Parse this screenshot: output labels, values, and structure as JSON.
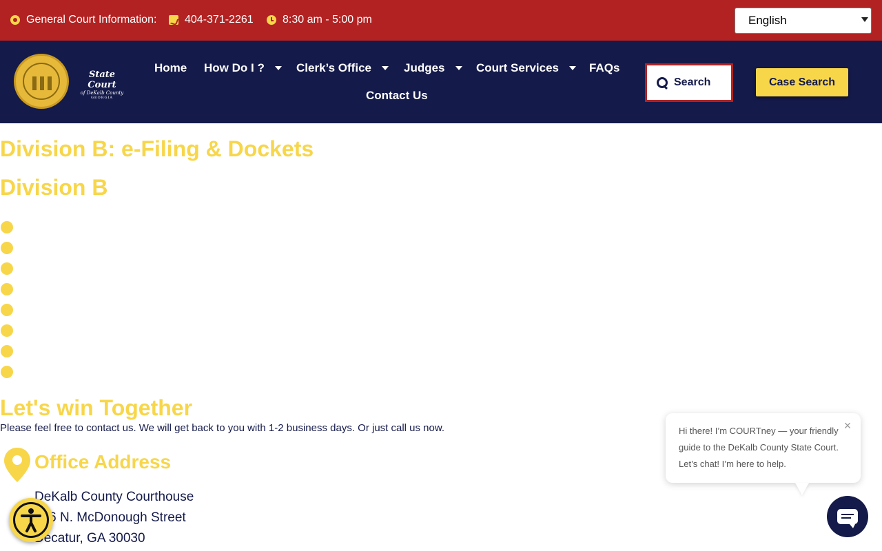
{
  "topbar": {
    "court_info_label": "General Court Information:",
    "phone": "404-371-2261",
    "hours": "8:30 am - 5:00 pm",
    "language": "English"
  },
  "logo": {
    "line1": "State Court",
    "line2": "of DeKalb County",
    "line3": "GEORGIA"
  },
  "nav": {
    "home": "Home",
    "how_do_i": "How Do I ?",
    "clerks_office": "Clerk’s Office",
    "judges": "Judges",
    "court_services": "Court Services",
    "faqs": "FAQs",
    "contact_us": "Contact Us",
    "search_label": "Search",
    "case_search": "Case Search"
  },
  "content": {
    "title": "Division B: e-Filing & Dockets",
    "subtitle": "Division B",
    "win_heading": "Let's win Together",
    "contact_text": "Please feel free to contact us. We will get back to you with 1-2 business days. Or just call us now.",
    "office_title": "Office Address",
    "address_lines": [
      "DeKalb County Courthouse",
      "556 N. McDonough Street",
      "Decatur, GA 30030"
    ]
  },
  "chat": {
    "message": "Hi there! I’m COURTney — your friendly guide to the DeKalb County State Court. Let’s chat! I’m here to help.",
    "close": "×"
  },
  "colors": {
    "red": "#b22222",
    "navy": "#141a4a",
    "yellow": "#f7d64a"
  }
}
